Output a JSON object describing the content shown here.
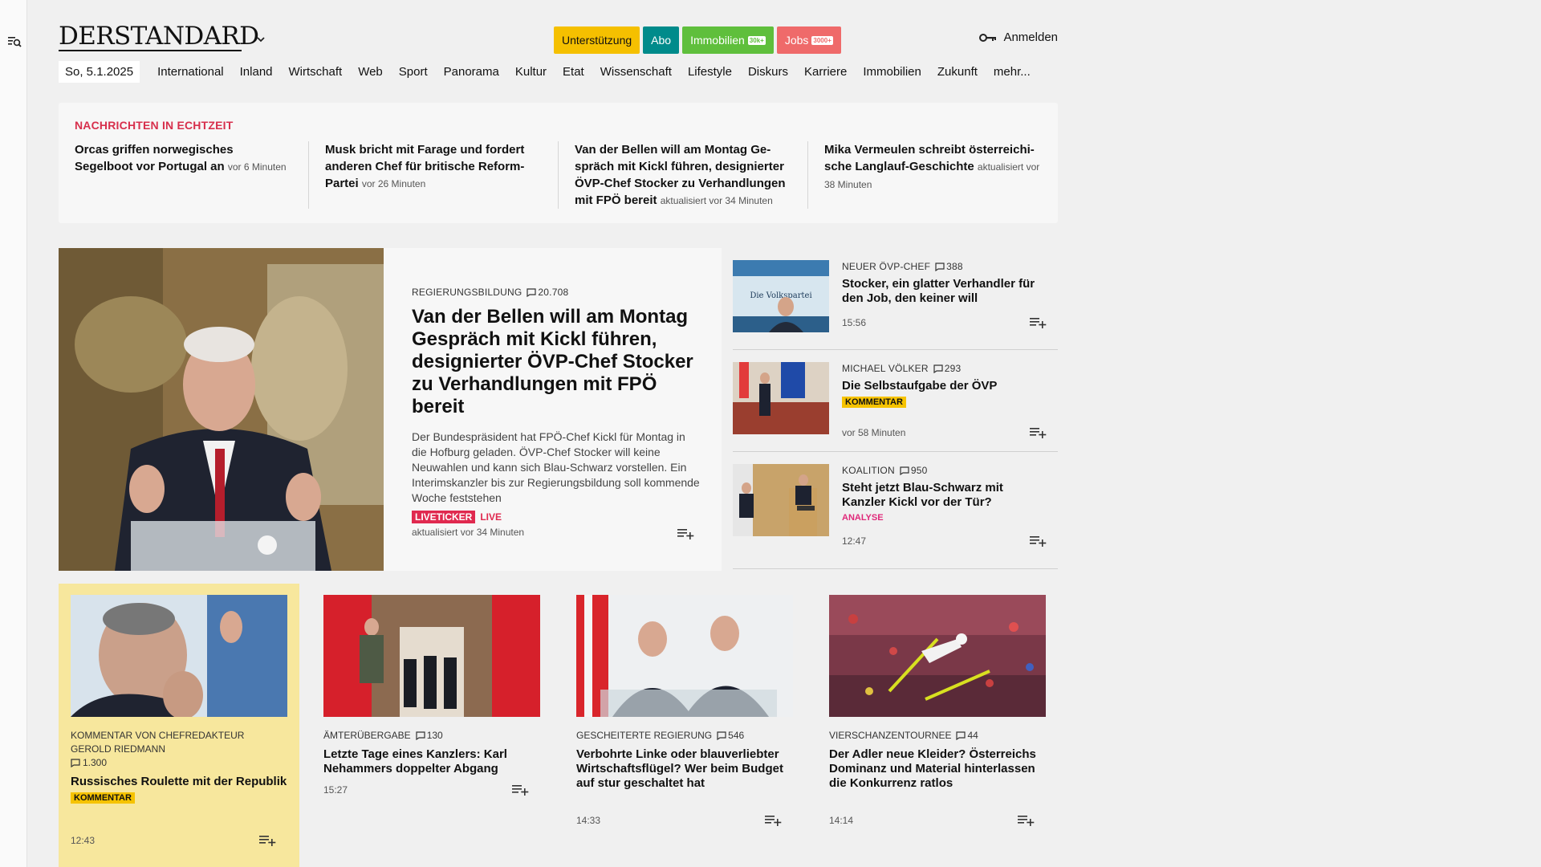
{
  "brand": {
    "logo": "DERSTANDARD"
  },
  "header": {
    "buttons": [
      {
        "label": "Unterstützung"
      },
      {
        "label": "Abo"
      },
      {
        "label": "Immobilien",
        "tag": "30k+"
      },
      {
        "label": "Jobs",
        "tag": "3000+"
      }
    ],
    "login_label": "Anmelden"
  },
  "nav": {
    "date": "So, 5.1.2025",
    "items": [
      "International",
      "Inland",
      "Wirtschaft",
      "Web",
      "Sport",
      "Panorama",
      "Kultur",
      "Etat",
      "Wissenschaft",
      "Lifestyle",
      "Diskurs",
      "Karriere",
      "Immobilien",
      "Zukunft",
      "mehr..."
    ]
  },
  "realtime": {
    "title": "NACHRICHTEN IN ECHTZEIT",
    "items": [
      {
        "headline": "Orcas griffen norwegisches Segelboot vor Portugal an",
        "time": "vor 6 Minuten"
      },
      {
        "headline": "Musk bricht mit Farage und fordert anderen Chef für britische Reform-Partei",
        "time": "vor 26 Minuten"
      },
      {
        "headline": "Van der Bellen will am Montag Ge-spräch mit Kickl führen, designierter ÖVP-Chef Stocker zu Verhandlungen mit FPÖ bereit",
        "time": "aktualisiert vor 34 Minuten"
      },
      {
        "headline": "Mika Vermeulen schreibt österreichi-sche Langlauf-Geschichte",
        "time": "aktualisiert vor 38 Minuten"
      }
    ]
  },
  "hero": {
    "kicker": "REGIERUNGSBILDUNG",
    "comments": "20.708",
    "title": "Van der Bellen will am Montag Gespräch mit Kickl führen, designierter ÖVP-Chef Stocker zu Verhandlungen mit FPÖ bereit",
    "teaser": "Der Bundespräsident hat FPÖ-Chef Kickl für Montag in die Hofburg geladen. ÖVP-Chef Stocker will keine Neuwahlen und kann sich Blau-Schwarz vorstellen. Ein Interimskanzler bis zur Regierungsbildung soll kommende Woche feststehen",
    "badge1": "LIVETICKER",
    "badge2": "LIVE",
    "time": "aktualisiert vor 34 Minuten"
  },
  "side": [
    {
      "kicker": "NEUER ÖVP-CHEF",
      "comments": "388",
      "title": "Stocker, ein glatter Verhandler für den Job, den keiner will",
      "badge": "",
      "time": "15:56"
    },
    {
      "kicker": "MICHAEL VÖLKER",
      "comments": "293",
      "title": "Die Selbstaufgabe der ÖVP",
      "badge": "KOMMENTAR",
      "time": "vor 58 Minuten"
    },
    {
      "kicker": "KOALITION",
      "comments": "950",
      "title": "Steht jetzt Blau-Schwarz mit Kanzler Kickl vor der Tür?",
      "badge": "ANALYSE",
      "time": "12:47"
    }
  ],
  "cards": [
    {
      "kicker": "KOMMENTAR VON CHEFREDAKTEUR GEROLD RIEDMANN",
      "comments": "1.300",
      "title": "Russisches Roulette mit der Republik",
      "badge": "KOMMENTAR",
      "time": "12:43"
    },
    {
      "kicker": "ÄMTERÜBERGABE",
      "comments": "130",
      "title": "Letzte Tage eines Kanzlers: Karl Nehammers doppelter Abgang",
      "badge": "",
      "time": "15:27"
    },
    {
      "kicker": "GESCHEITERTE REGIERUNG",
      "comments": "546",
      "title": "Verbohrte Linke oder blauverliebter Wirtschaftsflügel? Wer beim Budget auf stur geschaltet hat",
      "badge": "",
      "time": "14:33"
    },
    {
      "kicker": "VIERSCHANZENTOURNEE",
      "comments": "44",
      "title": "Der Adler neue Kleider? Österreichs Dominanz und Material hinterlassen die Konkurrenz ratlos",
      "badge": "",
      "time": "14:14"
    }
  ],
  "images": {
    "side0_poster": "Die Volkspartei"
  },
  "colors": {
    "accent_red": "#d72f4c",
    "live": "#e0294f",
    "kommentar": "#f6c300",
    "analyse": "#e0297a",
    "opinion_bg": "#f7e79d"
  }
}
